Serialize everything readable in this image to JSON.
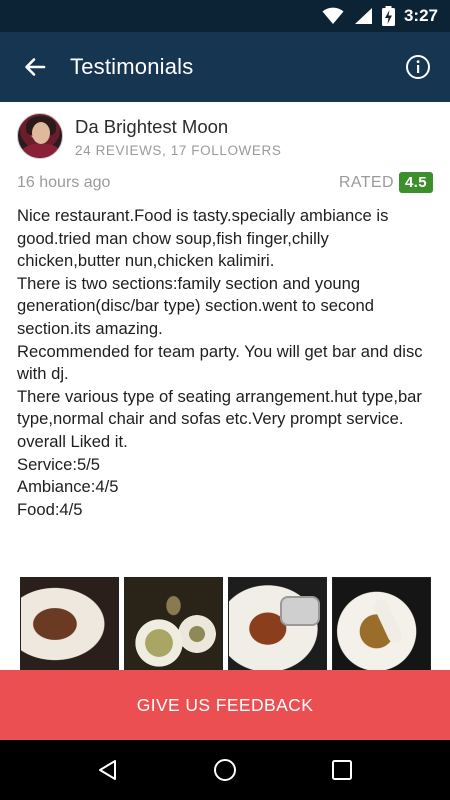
{
  "status_bar": {
    "time": "3:27",
    "icons": [
      "wifi-icon",
      "signal-icon",
      "battery-charging-icon"
    ]
  },
  "app_bar": {
    "title": "Testimonials",
    "back_icon": "arrow-back-icon",
    "info_icon": "info-icon"
  },
  "review": {
    "author": {
      "name": "Da Brightest Moon",
      "stats": "24 REVIEWS, 17 FOLLOWERS"
    },
    "time_ago": "16 hours ago",
    "rated_label": "RATED",
    "rating": "4.5",
    "rating_color": "#3c8f2b",
    "lines": [
      "Nice restaurant.Food is tasty.specially ambiance is good.tried man chow soup,fish finger,chilly chicken,butter nun,chicken kalimiri.",
      "There is two sections:family section and young generation(disc/bar type) section.went to second section.its amazing.",
      "Recommended for team party. You will get bar and disc with dj.",
      "There various type of seating arrangement.hut type,bar type,normal chair and sofas etc.Very prompt service.",
      "overall Liked it.",
      "Service:5/5",
      "Ambiance:4/5",
      "Food:4/5"
    ],
    "photo_count": 4
  },
  "feedback_button": {
    "label": "GIVE US FEEDBACK",
    "color": "#ec4f51"
  },
  "nav_bar": {
    "buttons": [
      "back-triangle-icon",
      "home-circle-icon",
      "recents-square-icon"
    ]
  }
}
